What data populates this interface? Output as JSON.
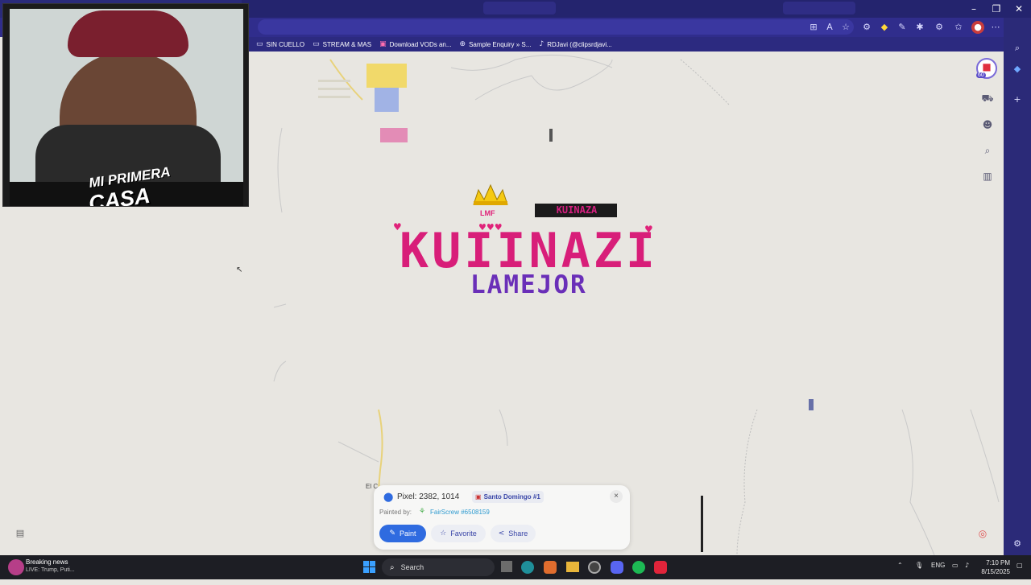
{
  "bookmarks": [
    {
      "label": "SIN CUELLO",
      "icon": "folder-icon"
    },
    {
      "label": "STREAM & MAS",
      "icon": "folder-icon"
    },
    {
      "label": "Download VODs an...",
      "icon": "page-icon"
    },
    {
      "label": "Sample Enquiry » S...",
      "icon": "globe-icon"
    },
    {
      "label": "RDJavi (@clipsrdjavi...",
      "icon": "tiktok-icon"
    }
  ],
  "webcam": {
    "overlay_line1": "MI PRIMERA",
    "overlay_line2": "CASA"
  },
  "map": {
    "art_main": "KUIINAZI",
    "art_sub": "LAMEJOR",
    "art_badge": "KUINAZA",
    "art_crown_label": "LMF",
    "place_label": "El C",
    "counter": "60"
  },
  "popup": {
    "pixel_label": "Pixel: 2382, 1014",
    "region": "Santo Domingo #1",
    "painted_by_label": "Painted by:",
    "painter": "FairScrew #6508159",
    "paint_label": "Paint",
    "favorite_label": "Favorite",
    "share_label": "Share",
    "close_label": "×"
  },
  "taskbar": {
    "news_title": "Breaking news",
    "news_sub": "LIVE: Trump, Puti...",
    "search_placeholder": "Search",
    "lang": "ENG",
    "time": "7:10 PM",
    "date": "8/15/2025"
  },
  "colors": {
    "brand_purple": "#302d8c",
    "accent_blue": "#2f6be0",
    "art_pink": "#d81e79",
    "art_purple": "#6a2fb8"
  }
}
